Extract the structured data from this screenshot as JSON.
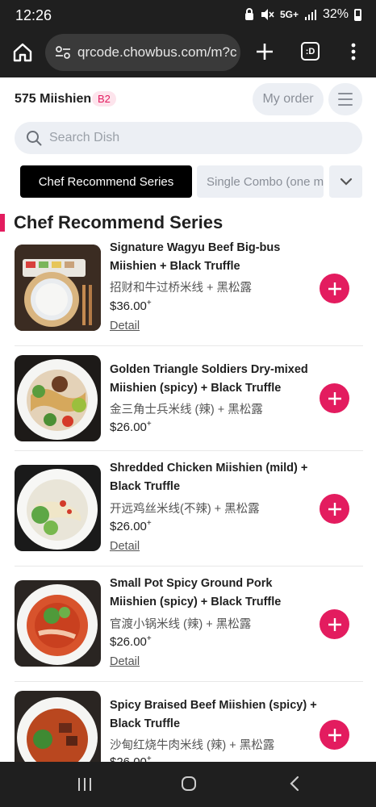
{
  "status_bar": {
    "time": "12:26",
    "network": "5G+",
    "battery": "32%"
  },
  "browser": {
    "url": "qrcode.chowbus.com/m?c",
    "tabs_label": ":D"
  },
  "header": {
    "store_name": "575 Miishien",
    "store_badge": "B2",
    "my_order_label": "My order"
  },
  "search": {
    "placeholder": "Search Dish"
  },
  "category_tabs": [
    {
      "label": "Chef Recommend Series",
      "active": true
    },
    {
      "label": "Single Combo (one m",
      "active": false
    }
  ],
  "section": {
    "title": "Chef Recommend Series"
  },
  "dishes": [
    {
      "title": "Signature Wagyu Beef Big-bus Miishien + Black Truffle",
      "cn": "招财和牛过桥米线 + 黑松露",
      "price": "$36.00",
      "price_plus": "+",
      "detail": "Detail"
    },
    {
      "title": "Golden Triangle Soldiers Dry-mixed Miishien (spicy) + Black Truffle",
      "cn": "金三角士兵米线 (辣) + 黑松露",
      "price": "$26.00",
      "price_plus": "+",
      "detail": ""
    },
    {
      "title": "Shredded Chicken Miishien (mild) + Black Truffle",
      "cn": "开远鸡丝米线(不辣) + 黑松露",
      "price": "$26.00",
      "price_plus": "+",
      "detail": "Detail"
    },
    {
      "title": "Small Pot Spicy Ground Pork Miishien (spicy) + Black Truffle",
      "cn": "官渡小锅米线 (辣) + 黑松露",
      "price": "$26.00",
      "price_plus": "+",
      "detail": "Detail"
    },
    {
      "title": "Spicy Braised Beef Miishien (spicy) + Black Truffle",
      "cn": "沙甸红烧牛肉米线 (辣) + 黑松露",
      "price": "$26.00",
      "price_plus": "+",
      "detail": ""
    }
  ],
  "colors": {
    "accent": "#e31c5f",
    "dark_bar": "#1f1f1f",
    "chip_bg": "#eceff4"
  }
}
